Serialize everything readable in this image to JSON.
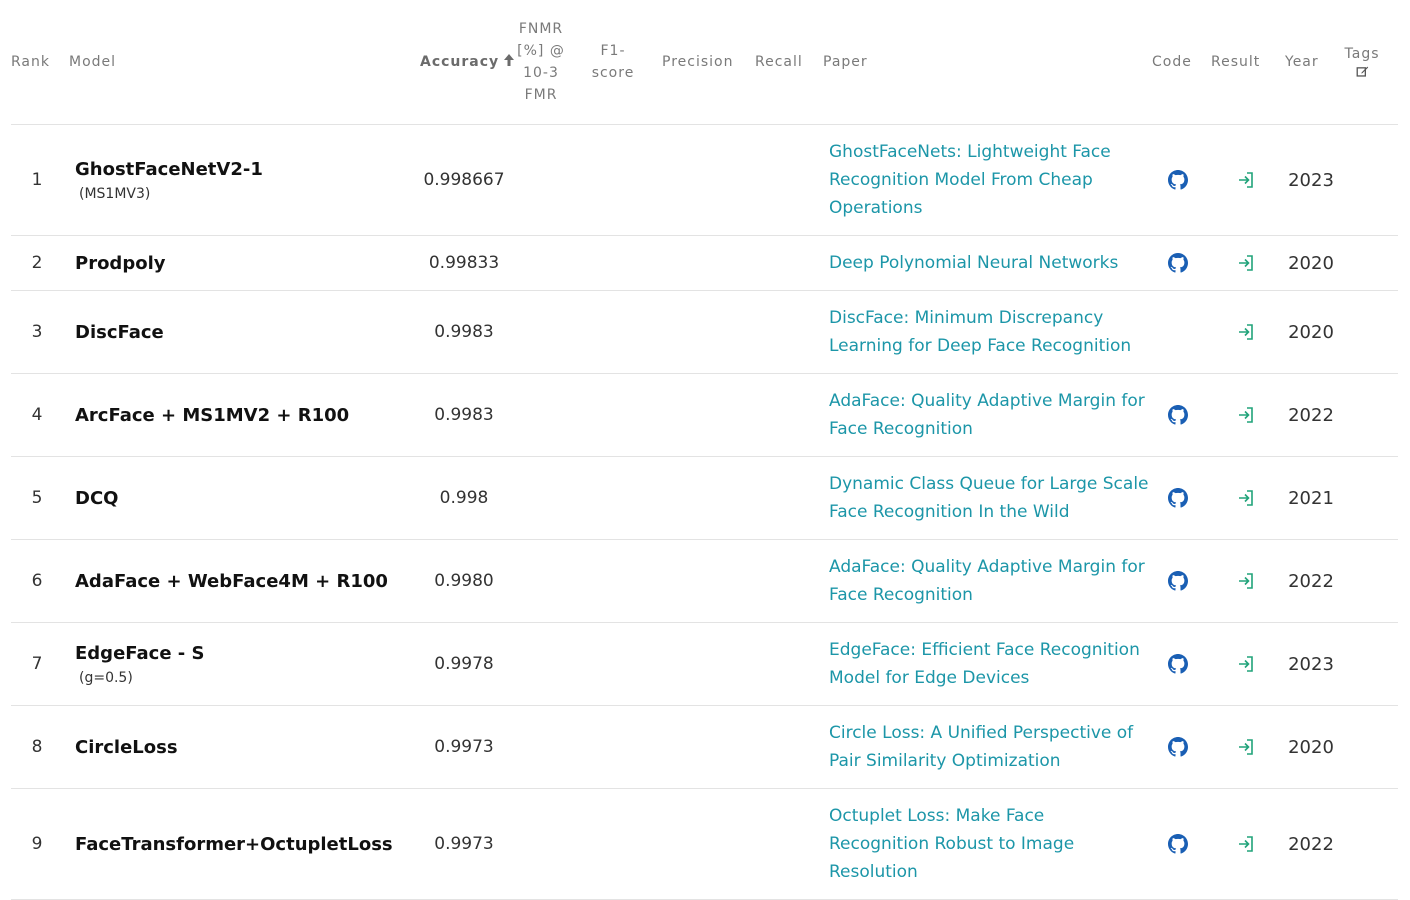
{
  "headers": {
    "rank": "Rank",
    "model": "Model",
    "accuracy": "Accuracy",
    "fnmr_lines": [
      "FNMR",
      "[%] @",
      "10-3",
      "FMR"
    ],
    "f1_lines": [
      "F1-",
      "score"
    ],
    "precision": "Precision",
    "recall": "Recall",
    "paper": "Paper",
    "code": "Code",
    "result": "Result",
    "year": "Year",
    "tags": "Tags"
  },
  "rows": [
    {
      "rank": "1",
      "model": "GhostFaceNetV2-1",
      "sub": "(MS1MV3)",
      "accuracy": "0.998667",
      "paper": "GhostFaceNets: Lightweight Face Recognition Model From Cheap Operations",
      "code": true,
      "year": "2023"
    },
    {
      "rank": "2",
      "model": "Prodpoly",
      "sub": "",
      "accuracy": "0.99833",
      "paper": "Deep Polynomial Neural Networks",
      "code": true,
      "year": "2020"
    },
    {
      "rank": "3",
      "model": "DiscFace",
      "sub": "",
      "accuracy": "0.9983",
      "paper": "DiscFace: Minimum Discrepancy Learning for Deep Face Recognition",
      "code": false,
      "year": "2020"
    },
    {
      "rank": "4",
      "model": "ArcFace + MS1MV2 + R100",
      "sub": "",
      "accuracy": "0.9983",
      "paper": "AdaFace: Quality Adaptive Margin for Face Recognition",
      "code": true,
      "year": "2022"
    },
    {
      "rank": "5",
      "model": "DCQ",
      "sub": "",
      "accuracy": "0.998",
      "paper": "Dynamic Class Queue for Large Scale Face Recognition In the Wild",
      "code": true,
      "year": "2021"
    },
    {
      "rank": "6",
      "model": "AdaFace + WebFace4M + R100",
      "sub": "",
      "accuracy": "0.9980",
      "paper": "AdaFace: Quality Adaptive Margin for Face Recognition",
      "code": true,
      "year": "2022"
    },
    {
      "rank": "7",
      "model": "EdgeFace - S",
      "sub": "(g=0.5)",
      "accuracy": "0.9978",
      "paper": "EdgeFace: Efficient Face Recognition Model for Edge Devices",
      "code": true,
      "year": "2023"
    },
    {
      "rank": "8",
      "model": "CircleLoss",
      "sub": "",
      "accuracy": "0.9973",
      "paper": "Circle Loss: A Unified Perspective of Pair Similarity Optimization",
      "code": true,
      "year": "2020"
    },
    {
      "rank": "9",
      "model": "FaceTransformer+OctupletLoss",
      "sub": "",
      "accuracy": "0.9973",
      "paper": "Octuplet Loss: Make Face Recognition Robust to Image Resolution",
      "code": true,
      "year": "2022"
    }
  ],
  "colors": {
    "link": "#1c96a8",
    "code_icon": "#1a5fb4",
    "result_icon": "#21a37a"
  },
  "icons": {
    "code": "github-icon",
    "result": "result-login-icon",
    "tags": "edit-icon",
    "sort": "arrow-up-icon"
  }
}
